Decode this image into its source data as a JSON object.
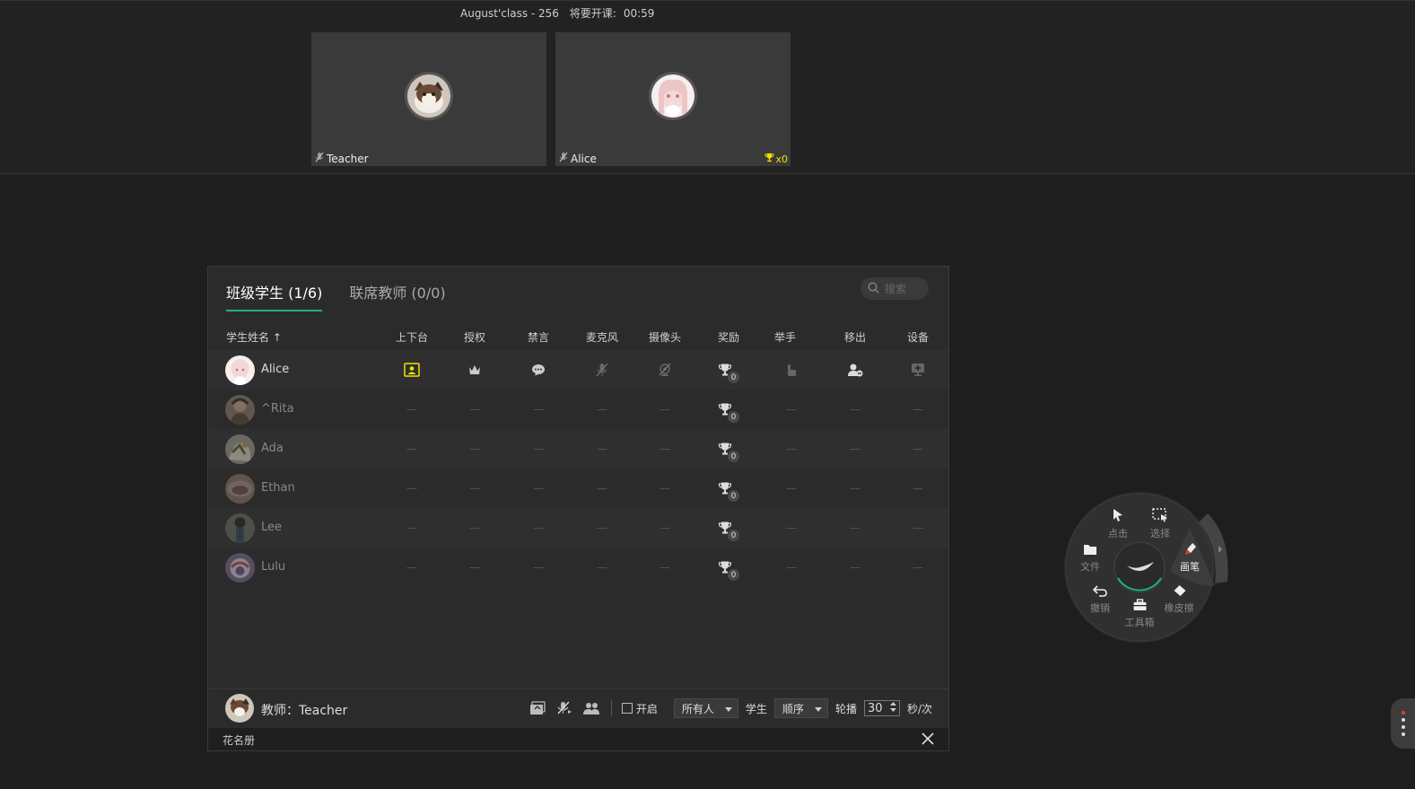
{
  "header": {
    "class_name": "August'class - 256",
    "countdown_label": "将要开课:",
    "countdown": "00:59"
  },
  "videos": [
    {
      "name": "Teacher",
      "mic": "muted"
    },
    {
      "name": "Alice",
      "mic": "muted",
      "trophies": "x0"
    }
  ],
  "roster": {
    "tabs": [
      {
        "label": "班级学生 (1/6)",
        "active": true
      },
      {
        "label": "联席教师 (0/0)",
        "active": false
      }
    ],
    "search_placeholder": "搜索",
    "columns": {
      "name": "学生姓名 ↑",
      "stage": "上下台",
      "authorize": "授权",
      "mute_chat": "禁言",
      "mic": "麦克风",
      "camera": "摄像头",
      "reward": "奖励",
      "hand": "举手",
      "remove": "移出",
      "device": "设备"
    },
    "dash": "—",
    "students": [
      {
        "name": "Alice",
        "online": true,
        "reward": "0"
      },
      {
        "name": "^Rita",
        "online": false,
        "reward": "0"
      },
      {
        "name": "Ada",
        "online": false,
        "reward": "0"
      },
      {
        "name": "Ethan",
        "online": false,
        "reward": "0"
      },
      {
        "name": "Lee",
        "online": false,
        "reward": "0"
      },
      {
        "name": "Lulu",
        "online": false,
        "reward": "0"
      }
    ],
    "footer": {
      "teacher_label": "教师：Teacher",
      "enable_label": "开启",
      "audience_value": "所有人",
      "student_label": "学生",
      "order_value": "顺序",
      "rotate_label": "轮播",
      "interval_value": "30",
      "interval_unit": "秒/次"
    },
    "status_bar": {
      "label": "花名册"
    }
  },
  "tool_wheel": {
    "click": "点击",
    "select": "选择",
    "file": "文件",
    "pen": "画笔",
    "undo": "撤销",
    "eraser": "橡皮擦",
    "toolbox": "工具箱"
  },
  "colors": {
    "accent_green": "#1db57c",
    "stage_yellow": "#f3e000",
    "pen_red": "#e63a3a"
  }
}
